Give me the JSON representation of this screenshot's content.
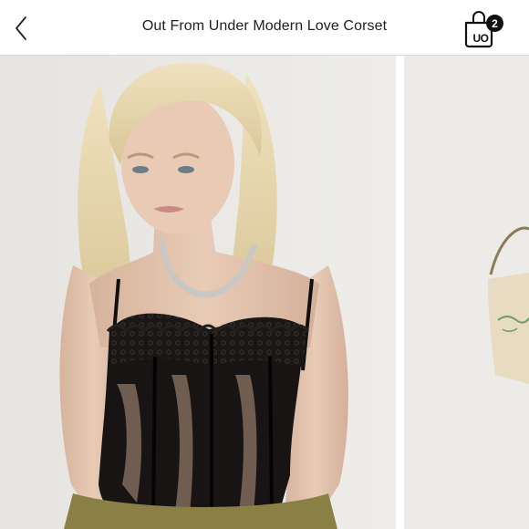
{
  "header": {
    "title": "Out From Under Modern Love Corset",
    "back_icon": "chevron-left-icon",
    "bag": {
      "brand_text": "UO",
      "count": "2",
      "icon": "shopping-bag-icon"
    }
  },
  "gallery": {
    "images": [
      {
        "alt": "Model wearing black lace corset with chain necklace"
      },
      {
        "alt": "Model with canvas tote bag"
      }
    ]
  },
  "colors": {
    "backdrop": "#e9e8e5",
    "corset": "#151313",
    "skin": "#e2c3ad",
    "hair": "#e6d3a7",
    "pants": "#8a7f45"
  }
}
